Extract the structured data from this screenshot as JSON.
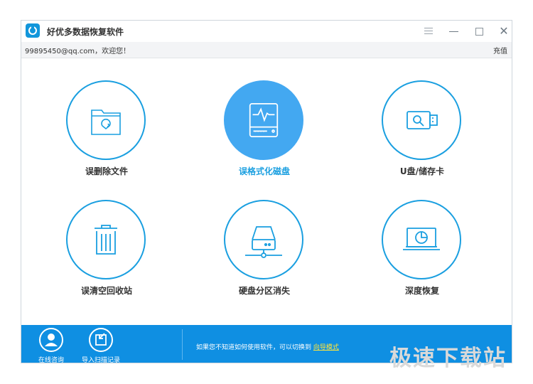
{
  "window": {
    "title": "好优多数据恢复软件",
    "icons": {
      "logo": "app-logo-icon",
      "menu": "menu-icon",
      "minimize": "minimize-icon",
      "maximize": "maximize-icon",
      "close": "close-icon"
    },
    "close_glyph": "✕"
  },
  "userbar": {
    "greeting": "99895450@qq.com，欢迎您！",
    "recharge": "充值"
  },
  "tiles": [
    {
      "label": "误删除文件",
      "icon": "deleted-file-folder-icon",
      "active": false
    },
    {
      "label": "误格式化磁盘",
      "icon": "formatted-disk-icon",
      "active": true
    },
    {
      "label": "U盘/储存卡",
      "icon": "usb-drive-icon",
      "active": false
    },
    {
      "label": "误清空回收站",
      "icon": "recycle-bin-icon",
      "active": false
    },
    {
      "label": "硬盘分区消失",
      "icon": "hard-drive-partition-icon",
      "active": false
    },
    {
      "label": "深度恢复",
      "icon": "deep-recovery-laptop-icon",
      "active": false
    }
  ],
  "footer": {
    "online_consult": "在线咨询",
    "import_scan": "导入扫描记录",
    "tip_text": "如果您不知道如何使用软件，可以切换到",
    "guide_link": "向导模式"
  },
  "watermark": "极速下载站",
  "colors": {
    "accent": "#1a9fe0",
    "active_tile": "#43a8f1",
    "footer_bg": "#0f8fe2",
    "guide_link": "#ffe43a"
  }
}
